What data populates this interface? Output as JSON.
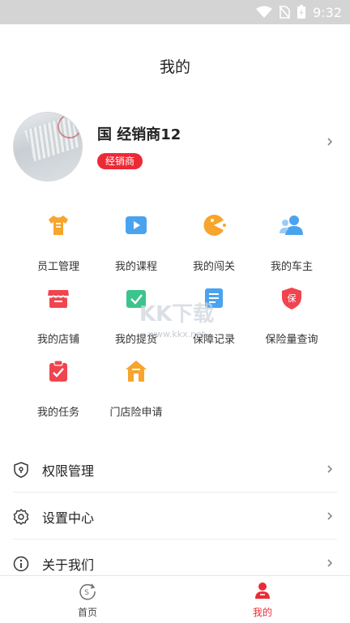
{
  "status_bar": {
    "time": "9:32"
  },
  "header": {
    "title": "我的"
  },
  "profile": {
    "name": "国 经销商12",
    "role": "经销商"
  },
  "features": [
    {
      "label": "员工管理",
      "icon": "tshirt-icon",
      "color": "#f7a52c"
    },
    {
      "label": "我的课程",
      "icon": "video-play-icon",
      "color": "#4aa3ef"
    },
    {
      "label": "我的闯关",
      "icon": "game-pacman-icon",
      "color": "#f7a52c"
    },
    {
      "label": "我的车主",
      "icon": "users-icon",
      "color": "#4aa3ef"
    },
    {
      "label": "我的店铺",
      "icon": "store-icon",
      "color": "#f0454e"
    },
    {
      "label": "我的提货",
      "icon": "pickup-icon",
      "color": "#3cc48c"
    },
    {
      "label": "保障记录",
      "icon": "list-icon",
      "color": "#4aa3ef"
    },
    {
      "label": "保险量查询",
      "icon": "shield-icon",
      "color": "#f0454e"
    },
    {
      "label": "我的任务",
      "icon": "clipboard-check-icon",
      "color": "#f0454e"
    },
    {
      "label": "门店险申请",
      "icon": "house-icon",
      "color": "#f7a52c"
    }
  ],
  "menu": [
    {
      "label": "权限管理",
      "icon": "shield-outline-icon"
    },
    {
      "label": "设置中心",
      "icon": "gear-icon"
    },
    {
      "label": "关于我们",
      "icon": "info-icon"
    }
  ],
  "tabs": [
    {
      "label": "首页",
      "icon": "home-tab-icon",
      "color": "#444444"
    },
    {
      "label": "我的",
      "icon": "profile-tab-icon",
      "color": "#ec2a36"
    }
  ],
  "watermark": {
    "text": "KK下载",
    "url": "www.kkx.net"
  },
  "colors": {
    "accent": "#ec2a36",
    "orange": "#f7a52c",
    "blue": "#4aa3ef",
    "green": "#3cc48c"
  }
}
